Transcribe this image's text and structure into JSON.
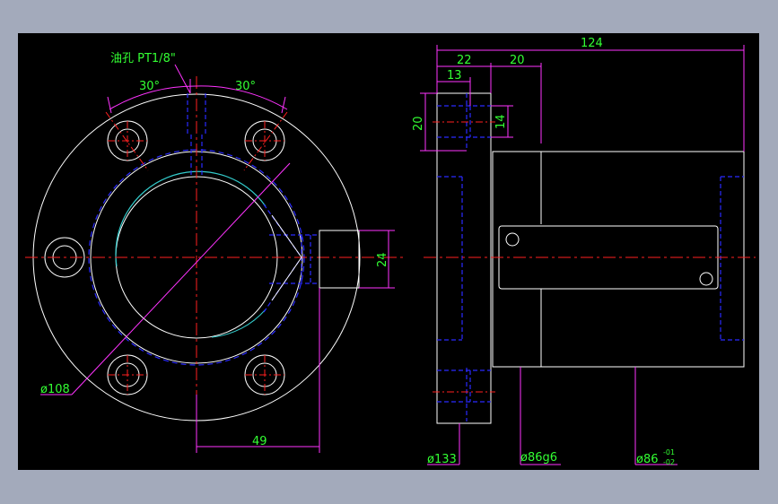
{
  "colors": {
    "background": "#a3aabb",
    "canvas": "#000000",
    "outline": "#ffffff",
    "centerline": "#ff2020",
    "hidden": "#2a2aff",
    "dimension": "#ff33ff",
    "dim_text": "#33ff33",
    "thread": "#33cccc"
  },
  "front_view": {
    "callout_label": "油孔 PT1/8\"",
    "angle_left": "30°",
    "angle_right": "30°",
    "dim_height": "24",
    "dim_width": "49",
    "dim_diameter": "ø108"
  },
  "side_view": {
    "dim_total": "124",
    "dim_22": "22",
    "dim_20_top": "20",
    "dim_13": "13",
    "dim_20_left": "20",
    "dim_14": "14",
    "dim_133": "ø133",
    "dim_86g6": "ø86g6",
    "dim_86_base": "ø86",
    "dim_86_tol_upper": "-01",
    "dim_86_tol_lower": "-02"
  }
}
